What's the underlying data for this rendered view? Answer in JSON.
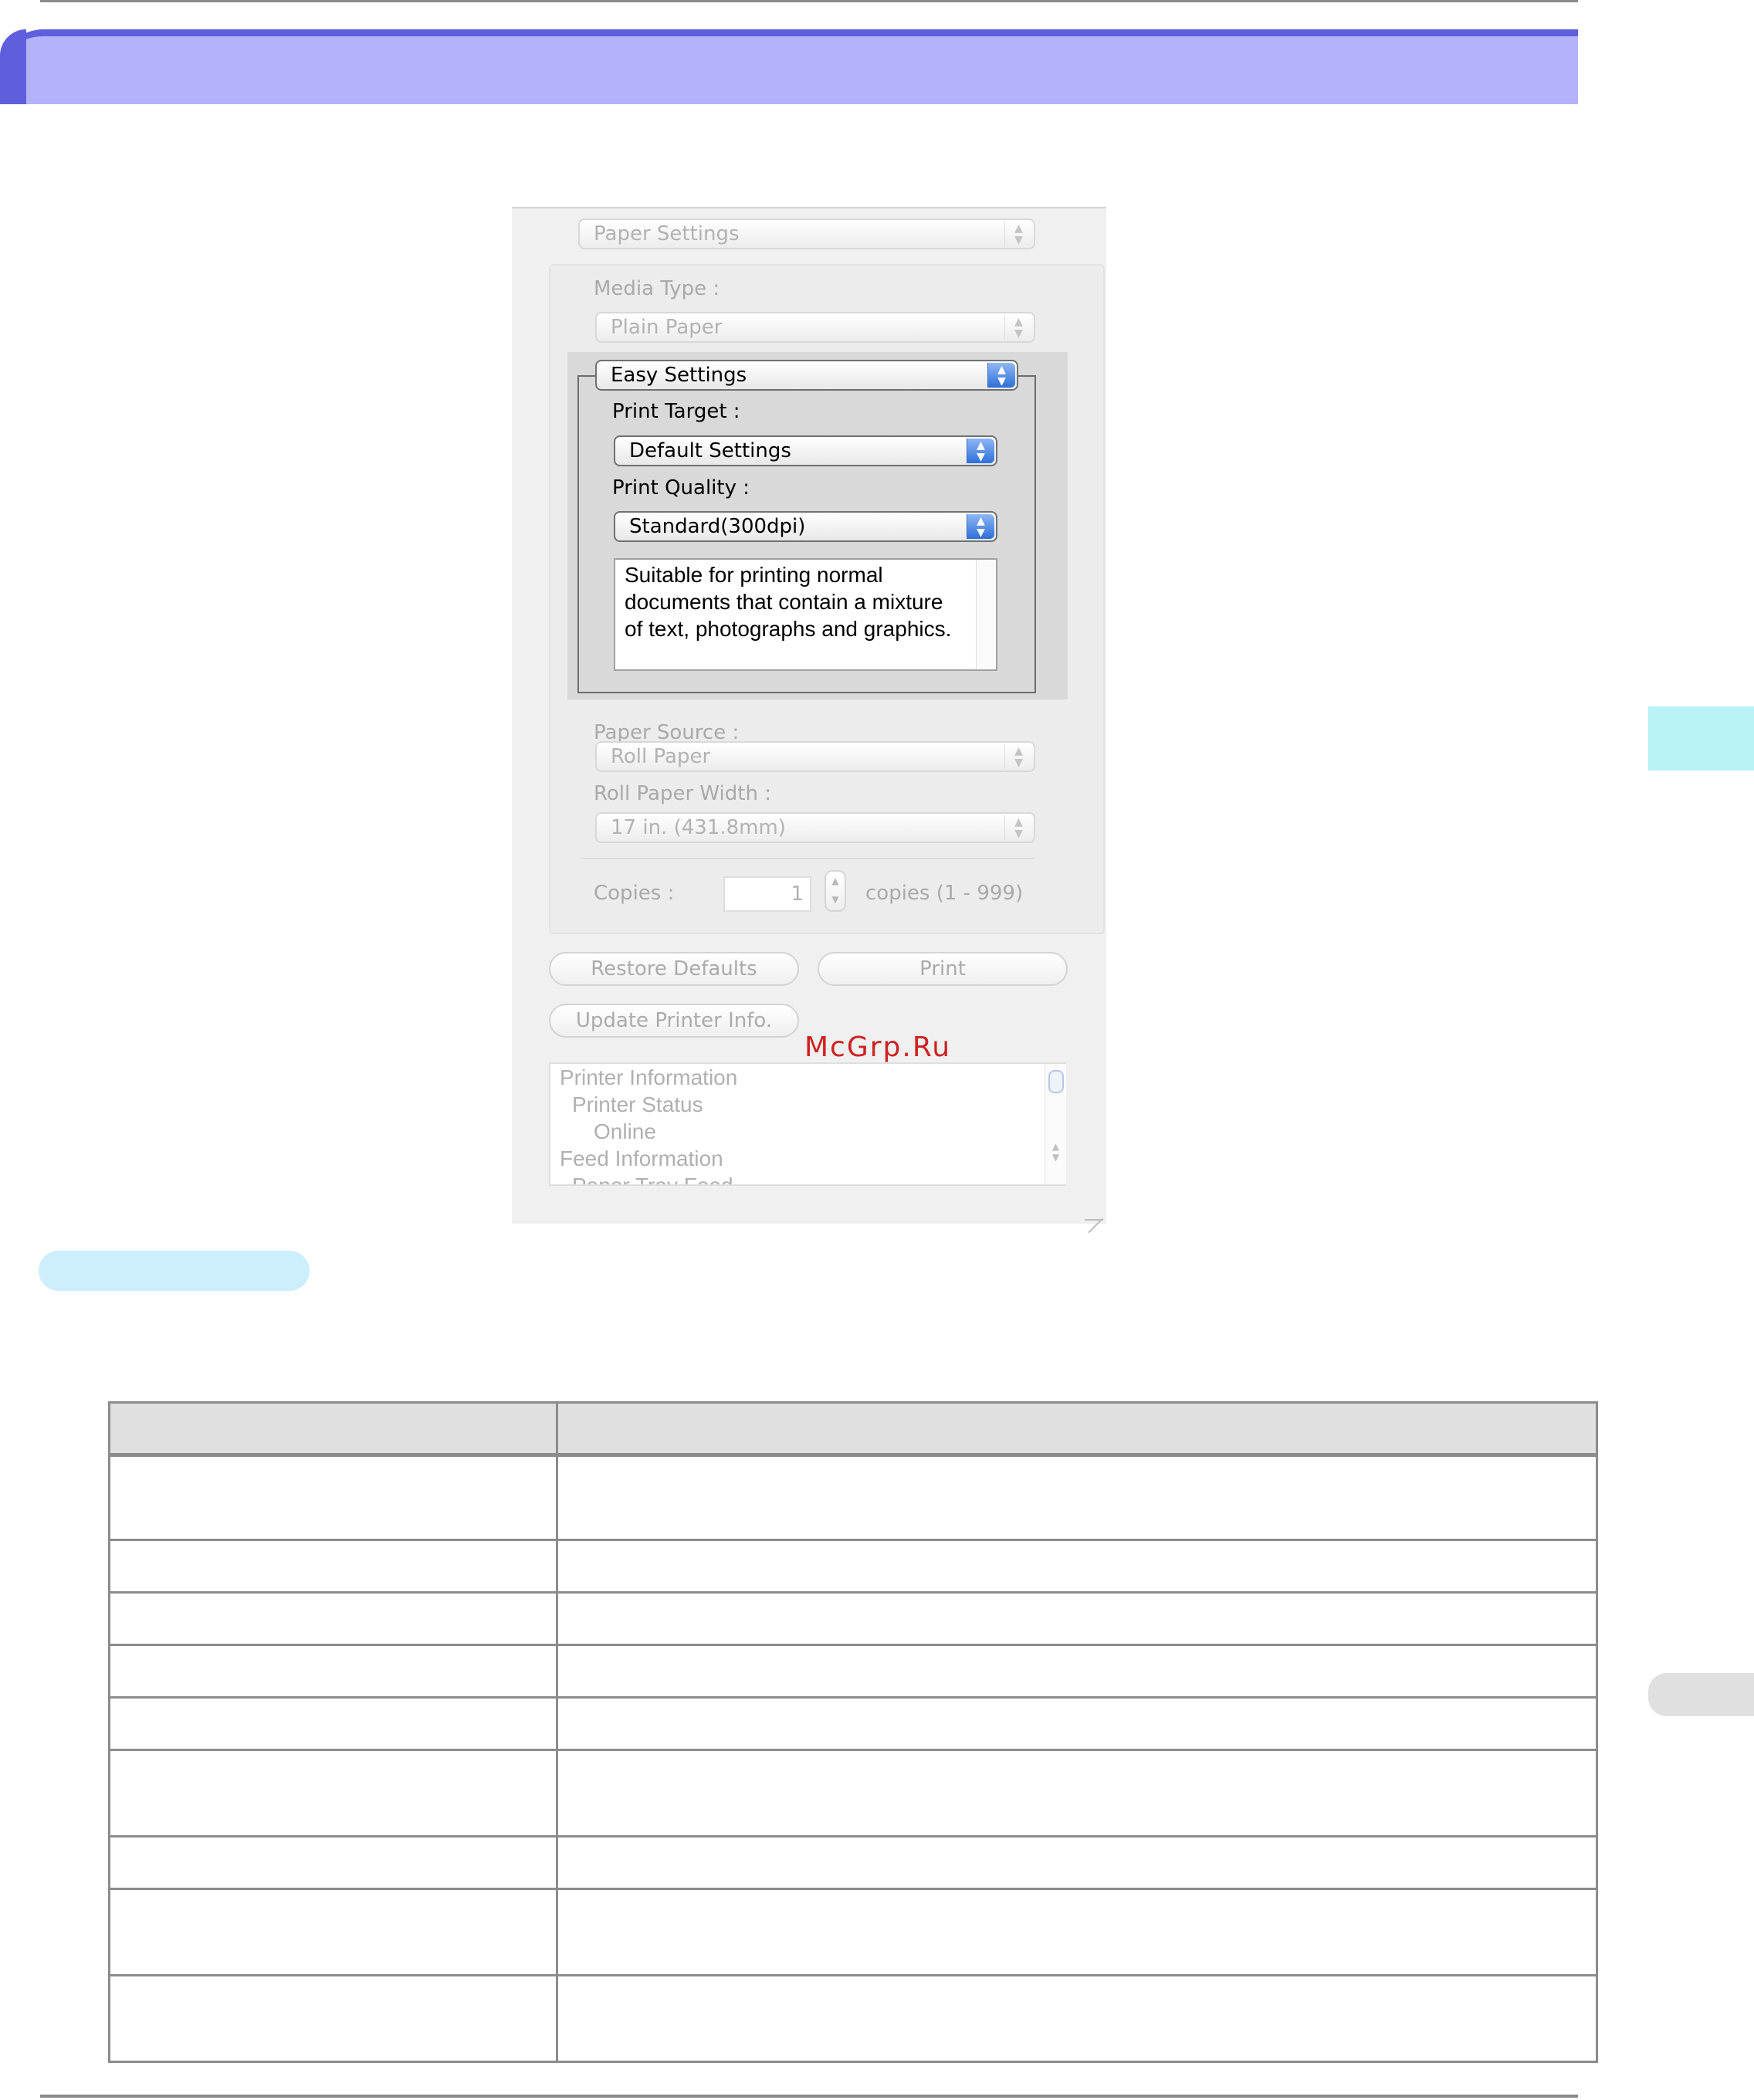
{
  "dialog": {
    "paper_settings_popup": "Paper Settings",
    "media_type_label": "Media Type :",
    "media_type_value": "Plain Paper",
    "easy_settings_popup": "Easy Settings",
    "print_target_label": "Print Target :",
    "print_target_value": "Default Settings",
    "print_quality_label": "Print Quality :",
    "print_quality_value": "Standard(300dpi)",
    "quality_description": "Suitable for printing normal documents that contain a mixture of text, photographs and graphics.",
    "paper_source_label": "Paper Source :",
    "paper_source_value": "Roll Paper",
    "roll_width_label": "Roll Paper Width :",
    "roll_width_value": "17 in. (431.8mm)",
    "copies_label": "Copies :",
    "copies_value": "1",
    "copies_range": "copies (1 - 999)",
    "restore_defaults_button": "Restore Defaults",
    "print_button": "Print",
    "update_info_button": "Update Printer Info.",
    "info_list": [
      "Printer Information",
      "Printer Status",
      "Online",
      "Feed Information",
      "Paper Tray Feed"
    ]
  },
  "watermark": "McGrp.Ru",
  "icons": {
    "popup_arrows": "up-down-chevron-icon",
    "stepper_arrows": "stepper-icon",
    "resize_grip": "resize-grip-icon"
  },
  "colors": {
    "header_band": "#b3b3fb",
    "header_accent": "#5f5fdd",
    "side_tab": "#b8f2f5",
    "section_pill": "#cdeefc",
    "table_border": "#8c8c8c",
    "table_header": "#e0e0e0"
  }
}
